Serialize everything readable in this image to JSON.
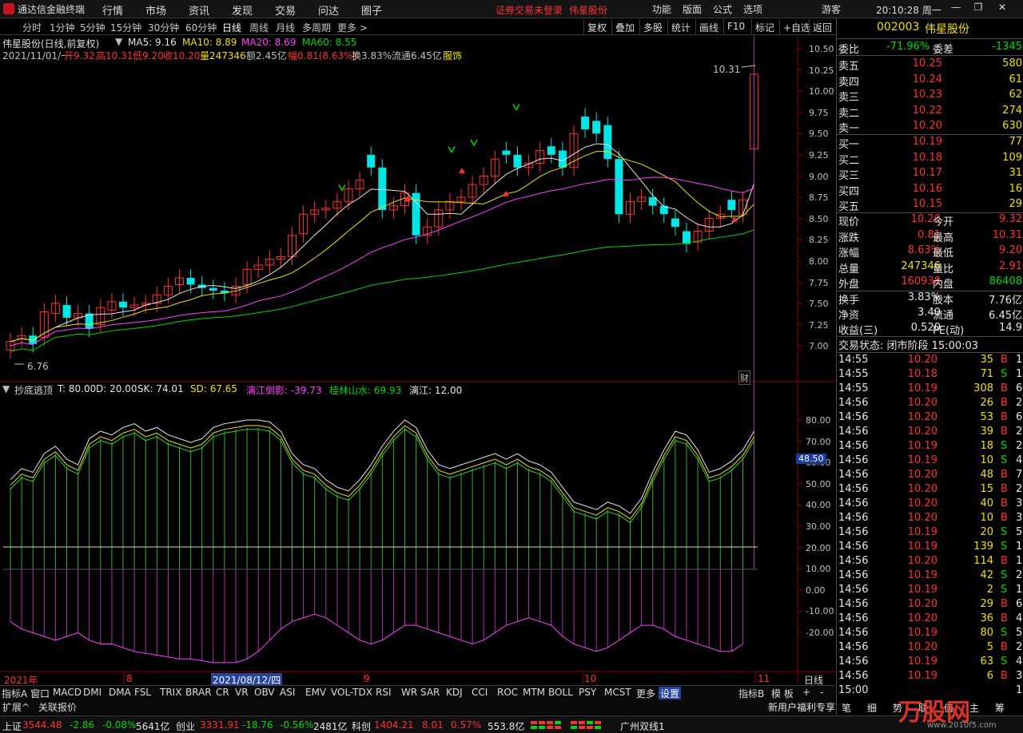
{
  "app": {
    "title": "通达信金融终端",
    "menu": [
      "行情",
      "市场",
      "资讯",
      "发现",
      "交易",
      "问达",
      "圈子"
    ],
    "warning": "证券交易未登录",
    "warning_stock": "伟星股份",
    "menu_right": [
      "功能",
      "版面",
      "公式",
      "选项"
    ],
    "user": "游客",
    "clock": "20:10:28 周一"
  },
  "toolbar": {
    "periods": [
      "分时",
      "1分钟",
      "5分钟",
      "15分钟",
      "30分钟",
      "60分钟",
      "日线",
      "周线",
      "月线",
      "多周期",
      "更多"
    ],
    "active": "日线",
    "more_arrow": ">",
    "right_buttons": [
      "复权",
      "叠加",
      "多股",
      "统计",
      "画线",
      "F10",
      "标记",
      "+自选",
      "返回"
    ]
  },
  "kline": {
    "title": "伟星股份(日线,前复权)",
    "ma5": "MA5: 9.16",
    "ma10": "MA10: 8.89",
    "ma20": "MA20: 8.69",
    "ma60": "MA60: 8.55",
    "info": [
      "2021/11/01/一",
      "开9.32",
      "高10.31",
      "低9.20",
      "收10.20",
      "量247346",
      "额2.45亿",
      "幅0.81(8.63%)",
      "换3.83%",
      "流通6.45亿",
      "服饰"
    ],
    "high_label": "10.31",
    "low_label": "6.76",
    "event_badge": "财",
    "price_ticks": [
      "10.50",
      "10.25",
      "10.00",
      "9.75",
      "9.50",
      "9.25",
      "9.00",
      "8.75",
      "8.50",
      "8.25",
      "8.00",
      "7.75",
      "7.50",
      "7.25",
      "7.00"
    ]
  },
  "indicator": {
    "name": "抄底逃顶",
    "T": "T: 80.00",
    "D": "D: 20.00",
    "SK": "SK: 74.01",
    "SD": "SD: 67.65",
    "lijiang": "漓江倒影: -39.73",
    "guilin": "桂林山水: 69.93",
    "lijiang2": "漓江: 12.00",
    "ticks": [
      "80.00",
      "70.00",
      "60.00",
      "50.00",
      "40.00",
      "30.00",
      "20.00",
      "10.00",
      "0.00",
      "-10.00",
      "-20.00"
    ],
    "cursor_value": "48.50"
  },
  "date_axis": {
    "labels": [
      "2021年",
      "8",
      "9",
      "10",
      "11"
    ],
    "highlight": "2021/08/12/四",
    "period": "日线"
  },
  "indicator_tabs": [
    "指标A",
    "窗口",
    "MACD",
    "DMI",
    "DMA",
    "FSL",
    "TRIX",
    "BRAR",
    "CR",
    "VR",
    "OBV",
    "ASI",
    "EMV",
    "VOL-TDX",
    "RSI",
    "WR",
    "SAR",
    "KDJ",
    "CCI",
    "ROC",
    "MTM",
    "BOLL",
    "PSY",
    "MCST",
    "更多",
    "设置"
  ],
  "indicator_tab_active": "设置",
  "indicator_b": "指标B",
  "moban": "模 板",
  "plus": "+",
  "minus": "-",
  "ext_tabs": [
    "扩展^",
    "关联报价"
  ],
  "quote": {
    "code": "002003",
    "name": "伟星股份",
    "weibi_label": "委比",
    "weibi": "-71.96%",
    "weicha_label": "委差",
    "weicha": "-1345",
    "asks": [
      {
        "l": "卖五",
        "p": "10.25",
        "v": "580"
      },
      {
        "l": "卖四",
        "p": "10.24",
        "v": "61"
      },
      {
        "l": "卖三",
        "p": "10.23",
        "v": "62"
      },
      {
        "l": "卖二",
        "p": "10.22",
        "v": "274"
      },
      {
        "l": "卖一",
        "p": "10.20",
        "v": "630"
      }
    ],
    "bids": [
      {
        "l": "买一",
        "p": "10.19",
        "v": "77"
      },
      {
        "l": "买二",
        "p": "10.18",
        "v": "109"
      },
      {
        "l": "买三",
        "p": "10.17",
        "v": "31"
      },
      {
        "l": "买四",
        "p": "10.16",
        "v": "16"
      },
      {
        "l": "买五",
        "p": "10.15",
        "v": "29"
      }
    ],
    "stats": [
      {
        "l1": "现价",
        "v1": "10.20",
        "c1": "red",
        "l2": "今开",
        "v2": "9.32",
        "c2": "red"
      },
      {
        "l1": "涨跌",
        "v1": "0.81",
        "c1": "red",
        "l2": "最高",
        "v2": "10.31",
        "c2": "red"
      },
      {
        "l1": "涨幅",
        "v1": "8.63%",
        "c1": "red",
        "l2": "最低",
        "v2": "9.20",
        "c2": "red"
      },
      {
        "l1": "总量",
        "v1": "247346",
        "c1": "yel",
        "l2": "量比",
        "v2": "2.91",
        "c2": "red"
      },
      {
        "l1": "外盘",
        "v1": "160938",
        "c1": "red",
        "l2": "内盘",
        "v2": "86408",
        "c2": "grn"
      }
    ],
    "stats2": [
      {
        "l1": "换手",
        "v1": "3.83%",
        "l2": "股本",
        "v2": "7.76亿"
      },
      {
        "l1": "净资",
        "v1": "3.40",
        "l2": "流通",
        "v2": "6.45亿"
      },
      {
        "l1": "收益(三)",
        "v1": "0.520",
        "l2": "PE(动)",
        "v2": "14.9"
      }
    ],
    "status": "交易状态: 闭市阶段 15:00:03",
    "ticks": [
      {
        "t": "14:55",
        "p": "10.20",
        "v": "35",
        "d": "B",
        "n": "1"
      },
      {
        "t": "14:55",
        "p": "10.18",
        "v": "71",
        "d": "S",
        "n": "1"
      },
      {
        "t": "14:55",
        "p": "10.19",
        "v": "308",
        "d": "B",
        "n": "6"
      },
      {
        "t": "14:56",
        "p": "10.20",
        "v": "26",
        "d": "B",
        "n": "2"
      },
      {
        "t": "14:56",
        "p": "10.20",
        "v": "53",
        "d": "B",
        "n": "6"
      },
      {
        "t": "14:56",
        "p": "10.20",
        "v": "39",
        "d": "B",
        "n": "2"
      },
      {
        "t": "14:56",
        "p": "10.19",
        "v": "18",
        "d": "S",
        "n": "2"
      },
      {
        "t": "14:56",
        "p": "10.19",
        "v": "10",
        "d": "S",
        "n": "4"
      },
      {
        "t": "14:56",
        "p": "10.20",
        "v": "48",
        "d": "B",
        "n": "7"
      },
      {
        "t": "14:56",
        "p": "10.20",
        "v": "15",
        "d": "B",
        "n": "2"
      },
      {
        "t": "14:56",
        "p": "10.20",
        "v": "40",
        "d": "B",
        "n": "3"
      },
      {
        "t": "14:56",
        "p": "10.20",
        "v": "10",
        "d": "B",
        "n": "3"
      },
      {
        "t": "14:56",
        "p": "10.19",
        "v": "20",
        "d": "S",
        "n": "5"
      },
      {
        "t": "14:56",
        "p": "10.19",
        "v": "139",
        "d": "S",
        "n": "10"
      },
      {
        "t": "14:56",
        "p": "10.20",
        "v": "114",
        "d": "B",
        "n": "11"
      },
      {
        "t": "14:56",
        "p": "10.19",
        "v": "42",
        "d": "S",
        "n": "2"
      },
      {
        "t": "14:56",
        "p": "10.19",
        "v": "2",
        "d": "S",
        "n": "1"
      },
      {
        "t": "14:56",
        "p": "10.20",
        "v": "29",
        "d": "B",
        "n": "6"
      },
      {
        "t": "14:56",
        "p": "10.20",
        "v": "36",
        "d": "B",
        "n": "4"
      },
      {
        "t": "14:56",
        "p": "10.19",
        "v": "80",
        "d": "S",
        "n": "5"
      },
      {
        "t": "14:56",
        "p": "10.20",
        "v": "5",
        "d": "B",
        "n": "2"
      },
      {
        "t": "14:56",
        "p": "10.19",
        "v": "63",
        "d": "S",
        "n": "4"
      },
      {
        "t": "14:56",
        "p": "10.19",
        "v": "6",
        "d": "B",
        "n": "3"
      },
      {
        "t": "15:00",
        "p": "",
        "v": "",
        "d": "",
        "n": "19"
      }
    ],
    "tab_labels": [
      "笔",
      "细",
      "势",
      "联",
      "值",
      "主",
      "筹"
    ],
    "promo": "新用户福利专享"
  },
  "statusbar": {
    "sh_label": "上证",
    "sh_val": "3544.48",
    "sh_chg": "-2.86",
    "sh_pct": "-0.08%",
    "sh_amt": "5641亿",
    "cy_label": "创业",
    "cy_val": "3331.91",
    "cy_chg": "-18.76",
    "cy_pct": "-0.56%",
    "cy_amt": "2481亿",
    "kc_label": "科创",
    "kc_val": "1404.21",
    "kc_chg": "8.01",
    "kc_pct": "0.57%",
    "kc_amt": "553.8亿",
    "server": "广州双线1"
  },
  "watermark": {
    "text": "万股网",
    "url": "www.2010f5.com"
  }
}
